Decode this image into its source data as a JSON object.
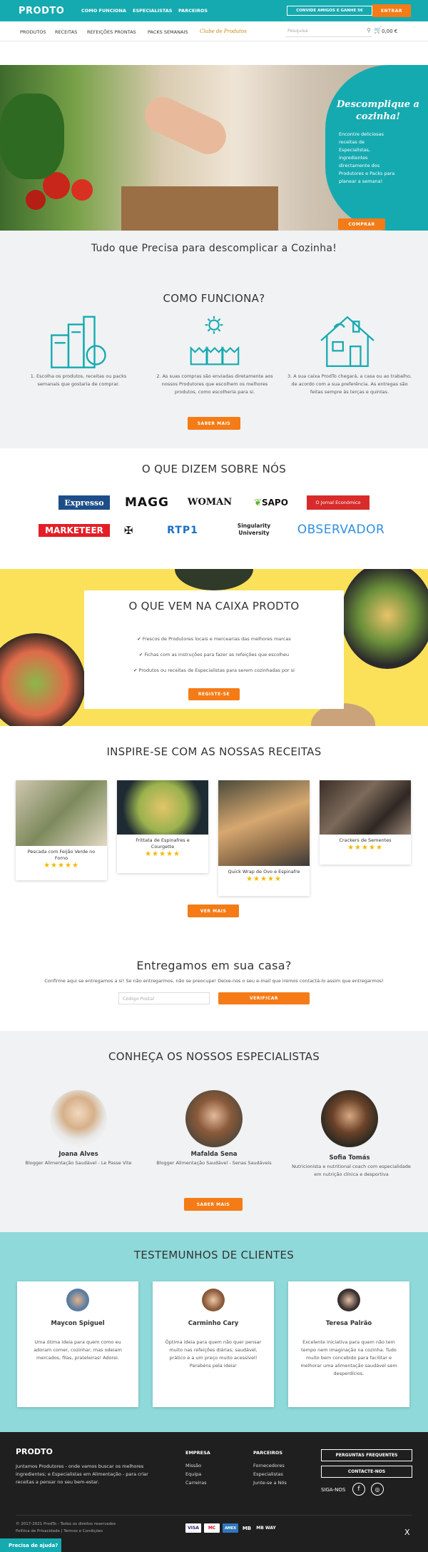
{
  "topbar": {
    "brand": "PRODTO",
    "nav": [
      "COMO FUNCIONA",
      "ESPECIALISTAS",
      "PARCEIROS"
    ],
    "invite": "CONVIDE AMIGOS E GANHE 5€",
    "login": "ENTRAR"
  },
  "menu": {
    "items": [
      "PRODUTOS",
      "RECEITAS",
      "REFEIÇÕES PRONTAS",
      "PACKS SEMANAIS"
    ],
    "club": "Clube de Produtos",
    "search_placeholder": "Pesquisa",
    "cart": "0,00 €"
  },
  "hero": {
    "title": "Descomplique a cozinha!",
    "text": "Encontre deliciosas receitas de Especialistas, ingredientes directamente dos Produtores e Packs para planear a semana!",
    "button": "COMPRAR"
  },
  "tagline": "Tudo que Precisa para descomplicar a Cozinha!",
  "how": {
    "title": "COMO FUNCIONA?",
    "steps": [
      "1. Escolha os produtos, receitas ou packs semanais que gostaria de comprar.",
      "2. As suas compras são enviadas diretamente aos nossos Produtores que escolhem os melhores produtos, como escolheria para si.",
      "3. A sua caixa ProdTo chegará, a casa ou ao trabalho, de acordo com a sua preferência. As entregas são feitas sempre às terças e quintas."
    ],
    "button": "SABER MAIS"
  },
  "press": {
    "title": "O QUE DIZEM SOBRE NÓS",
    "logos": [
      "Expresso",
      "MAGG",
      "WOMAN",
      "SAPO",
      "O Jornal Económico",
      "MARKETEER",
      "",
      "RTP1",
      "Singularity University",
      "OBSERVADOR"
    ]
  },
  "box": {
    "title": "O QUE VEM NA CAIXA PRODTO",
    "items": [
      "Frescos de Produtores locais e mercearias das melhores marcas",
      "Fichas com as instruções para fazer as refeições que escolheu",
      "Produtos ou receitas de Especialistas para serem cozinhadas por si"
    ],
    "button": "REGISTE-SE"
  },
  "recipes": {
    "title": "INSPIRE-SE COM AS NOSSAS RECEITAS",
    "items": [
      "Pescada com Feijão Verde no Forno",
      "Frittata de Espinafres e Courgette",
      "Quick Wrap de Ovo e Espinafre",
      "Crackers de Sementes"
    ],
    "button": "VER MAIS"
  },
  "delivery": {
    "title": "Entregamos em sua casa?",
    "text": "Confirme aqui se entregamos a si! Se não entregarmos, não se preocupe! Deixe-nos o seu e-mail que iremos contactá-lo assim que entregarmos!",
    "placeholder": "Código Postal",
    "button": "VERIFICAR"
  },
  "experts": {
    "title": "CONHEÇA OS NOSSOS ESPECIALISTAS",
    "people": [
      {
        "name": "Joana Alves",
        "role": "Blogger Alimentação Saudável - Le Passe Vite"
      },
      {
        "name": "Mafalda Sena",
        "role": "Blogger Alimentação Saudável - Senas Saudáveis"
      },
      {
        "name": "Sofia Tomás",
        "role": "Nutricionista e nutritional coach com especialidade em nutrição clínica e desportiva"
      }
    ],
    "button": "SABER MAIS"
  },
  "testimonials": {
    "title": "TESTEMUNHOS DE CLIENTES",
    "items": [
      {
        "name": "Maycon Spiguel",
        "text": "Uma ótima ideia para quem como eu adoram comer, cozinhar, mas odeiam mercados, filas, prateleiras! Adorei."
      },
      {
        "name": "Carminho Cary",
        "text": "Óptima ideia para quem não quer pensar muito nas refeições diárias; saudável, prático e a um preço muito acessível! Parabéns pela ideia!"
      },
      {
        "name": "Teresa Palrão",
        "text": "Excelente iniciativa para quem não tem tempo nem imaginação na cozinha. Tudo muito bem concebido para facilitar e melhorar uma alimentação saudável sem desperdícios."
      }
    ]
  },
  "footer": {
    "brand": "PRODTO",
    "about": "Juntamos Produtores - onde vamos buscar os melhores ingredientes; e Especialistas em Alimentação - para criar receitas a pensar no seu bem-estar.",
    "privacy": "Política de Privacidade | Termos e Condições",
    "col1_title": "EMPRESA",
    "col1": [
      "Missão",
      "Equipa",
      "Carreiras"
    ],
    "col2_title": "PARCEIROS",
    "col2": [
      "Fornecedores",
      "Especialistas",
      "Junte-se a Nós"
    ],
    "faq": "PERGUNTAS FREQUENTES",
    "contact": "CONTACTE-NOS",
    "follow": "SIGA-NOS",
    "copyright": "© 2017-2021 ProdTo - Todos os direitos reservados",
    "payments": [
      "VISA",
      "MC",
      "AMEX",
      "MB",
      "MB WAY"
    ],
    "help": "Precisa de ajuda?",
    "close": "X"
  },
  "colors": {
    "teal": "#15aab0",
    "orange": "#f47b16",
    "yellow": "#fbe05a",
    "aqua": "#8fd9da",
    "dark": "#1f1f1f"
  }
}
